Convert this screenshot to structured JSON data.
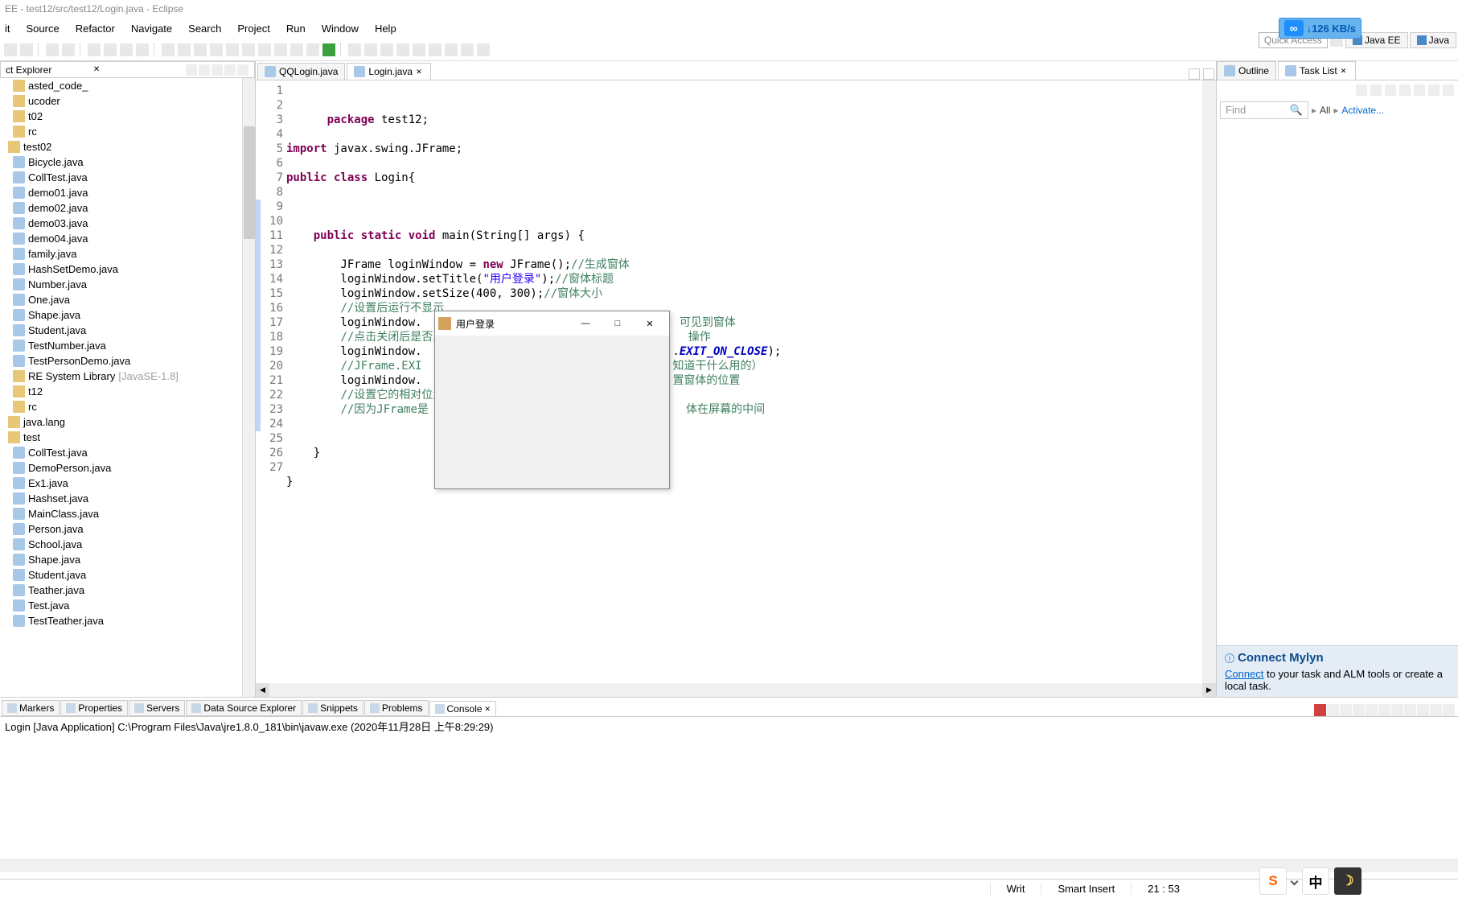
{
  "title_bar": "EE - test12/src/test12/Login.java - Eclipse",
  "menu": [
    "it",
    "Source",
    "Refactor",
    "Navigate",
    "Search",
    "Project",
    "Run",
    "Window",
    "Help"
  ],
  "network_badge": {
    "icon": "∞",
    "arrow": "↓",
    "rate": "126 KB/s"
  },
  "quick_access": {
    "text": "Quick Access"
  },
  "perspectives": [
    {
      "name": "Java EE"
    },
    {
      "name": "Java"
    }
  ],
  "project_explorer": {
    "title": "ct Explorer",
    "close": "✕",
    "items": [
      {
        "label": "asted_code_",
        "type": "folder"
      },
      {
        "label": "ucoder",
        "type": "folder"
      },
      {
        "label": "t02",
        "type": "folder"
      },
      {
        "label": "rc",
        "type": "folder"
      },
      {
        "label": "test02",
        "type": "pkg"
      },
      {
        "label": "Bicycle.java",
        "type": "java"
      },
      {
        "label": "CollTest.java",
        "type": "java"
      },
      {
        "label": "demo01.java",
        "type": "java"
      },
      {
        "label": "demo02.java",
        "type": "java"
      },
      {
        "label": "demo03.java",
        "type": "java"
      },
      {
        "label": "demo04.java",
        "type": "java"
      },
      {
        "label": "family.java",
        "type": "java"
      },
      {
        "label": "HashSetDemo.java",
        "type": "java"
      },
      {
        "label": "Number.java",
        "type": "java"
      },
      {
        "label": "One.java",
        "type": "java"
      },
      {
        "label": "Shape.java",
        "type": "java"
      },
      {
        "label": "Student.java",
        "type": "java"
      },
      {
        "label": "TestNumber.java",
        "type": "java"
      },
      {
        "label": "TestPersonDemo.java",
        "type": "java"
      },
      {
        "label": "RE System Library",
        "type": "folder",
        "deco": "[JavaSE-1.8]"
      },
      {
        "label": "t12",
        "type": "folder"
      },
      {
        "label": "rc",
        "type": "folder"
      },
      {
        "label": "java.lang",
        "type": "pkg"
      },
      {
        "label": "test",
        "type": "pkg"
      },
      {
        "label": "CollTest.java",
        "type": "java"
      },
      {
        "label": "DemoPerson.java",
        "type": "java"
      },
      {
        "label": "Ex1.java",
        "type": "java"
      },
      {
        "label": "Hashset.java",
        "type": "java"
      },
      {
        "label": "MainClass.java",
        "type": "java"
      },
      {
        "label": "Person.java",
        "type": "java"
      },
      {
        "label": "School.java",
        "type": "java"
      },
      {
        "label": "Shape.java",
        "type": "java"
      },
      {
        "label": "Student.java",
        "type": "java"
      },
      {
        "label": "Teather.java",
        "type": "java"
      },
      {
        "label": "Test.java",
        "type": "java"
      },
      {
        "label": "TestTeather.java",
        "type": "java"
      }
    ]
  },
  "editor": {
    "tabs": [
      {
        "name": "QQLogin.java"
      },
      {
        "name": "Login.java",
        "active": true
      }
    ],
    "lines": [
      {
        "n": 1,
        "html": "<span class='kw'>package</span> test12;"
      },
      {
        "n": 2,
        "html": ""
      },
      {
        "n": 3,
        "html": "<span class='kw'>import</span> javax.swing.JFrame;"
      },
      {
        "n": 4,
        "html": ""
      },
      {
        "n": 5,
        "html": "<span class='kw'>public class</span> Login{"
      },
      {
        "n": 6,
        "html": ""
      },
      {
        "n": 7,
        "html": ""
      },
      {
        "n": 8,
        "html": ""
      },
      {
        "n": 9,
        "html": "    <span class='kw'>public static void</span> main(String[] args) {"
      },
      {
        "n": 10,
        "html": ""
      },
      {
        "n": 11,
        "html": "        JFrame loginWindow = <span class='kw'>new</span> JFrame();<span class='com'>//生成窗体</span>"
      },
      {
        "n": 12,
        "html": "        loginWindow.setTitle(<span class='str'>\"用户登录\"</span>);<span class='com'>//窗体标题</span>"
      },
      {
        "n": 13,
        "html": "        loginWindow.setSize(400, 300);<span class='com'>//窗体大小</span>"
      },
      {
        "n": 14,
        "html": "        <span class='com'>//设置后运行不显示</span>"
      },
      {
        "n": 15,
        "html": "        loginWindow.                                      <span class='com'>可见到窗体</span>"
      },
      {
        "n": 16,
        "html": "        <span class='com'>//点击关闭后是否真</span>                                    <span class='com'>操作</span>"
      },
      {
        "n": 17,
        "html": "        loginWindow.                                     .<span class='const'>EXIT_ON_CLOSE</span>);"
      },
      {
        "n": 18,
        "html": "        <span class='com'>//JFrame.EXI</span>                                     <span class='com'>知道干什么用的）</span>"
      },
      {
        "n": 19,
        "html": "        loginWindow.                                     <span class='com'>置窗体的位置</span>"
      },
      {
        "n": 20,
        "html": "        <span class='com'>//设置它的相对位置</span>"
      },
      {
        "n": 21,
        "html": "        <span class='com'>//因为JFrame是</span>                                      <span class='com'>体在屏幕的中间</span>"
      },
      {
        "n": 22,
        "html": ""
      },
      {
        "n": 23,
        "html": ""
      },
      {
        "n": 24,
        "html": "    }"
      },
      {
        "n": 25,
        "html": ""
      },
      {
        "n": 26,
        "html": "}"
      },
      {
        "n": 27,
        "html": ""
      }
    ]
  },
  "dialog": {
    "title": "用户登录",
    "min": "—",
    "max": "□",
    "close": "✕"
  },
  "right": {
    "tabs": [
      {
        "name": "Outline"
      },
      {
        "name": "Task List",
        "active": true
      }
    ],
    "find": "Find",
    "all": "All",
    "activate": "Activate...",
    "mylyn_title": "Connect Mylyn",
    "mylyn_link": "Connect",
    "mylyn_rest": " to your task and ALM tools or create a local task."
  },
  "bottom": {
    "tabs": [
      {
        "name": "Markers"
      },
      {
        "name": "Properties"
      },
      {
        "name": "Servers"
      },
      {
        "name": "Data Source Explorer"
      },
      {
        "name": "Snippets"
      },
      {
        "name": "Problems"
      },
      {
        "name": "Console",
        "active": true
      }
    ],
    "console_head": "Login [Java Application] C:\\Program Files\\Java\\jre1.8.0_181\\bin\\javaw.exe (2020年11月28日 上午8:29:29)"
  },
  "status": {
    "writable": "Writ",
    "smart": "Smart Insert",
    "pos": "21 : 53"
  },
  "ime": {
    "sogou": "S",
    "zh": "中",
    "moon": "☽"
  }
}
